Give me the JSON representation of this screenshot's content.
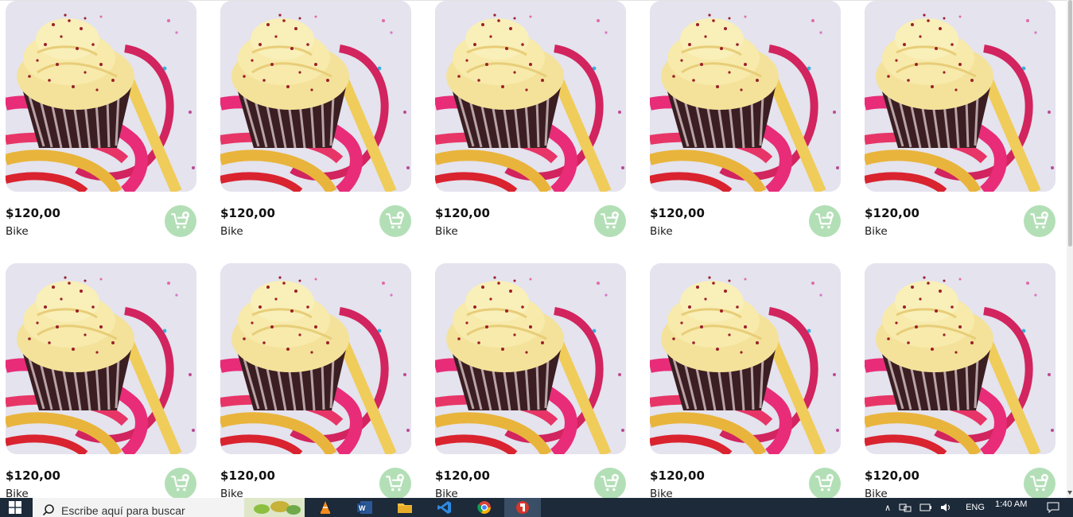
{
  "products": [
    {
      "price": "$120,00",
      "name": "Bike"
    },
    {
      "price": "$120,00",
      "name": "Bike"
    },
    {
      "price": "$120,00",
      "name": "Bike"
    },
    {
      "price": "$120,00",
      "name": "Bike"
    },
    {
      "price": "$120,00",
      "name": "Bike"
    },
    {
      "price": "$120,00",
      "name": "Bike"
    },
    {
      "price": "$120,00",
      "name": "Bike"
    },
    {
      "price": "$120,00",
      "name": "Bike"
    },
    {
      "price": "$120,00",
      "name": "Bike"
    },
    {
      "price": "$120,00",
      "name": "Bike"
    }
  ],
  "product_image": "cupcake-with-ribbons",
  "cart_icon": "add-to-cart-icon",
  "colors": {
    "cart_button": "#b3dfb6",
    "taskbar": "#1c2a3a"
  },
  "taskbar": {
    "search_placeholder": "Escribe aquí para buscar",
    "language": "ENG",
    "time": "1:40 AM",
    "apps": [
      "vlc-icon",
      "word-icon",
      "file-explorer-icon",
      "vscode-icon",
      "chrome-icon",
      "app-icon"
    ]
  }
}
